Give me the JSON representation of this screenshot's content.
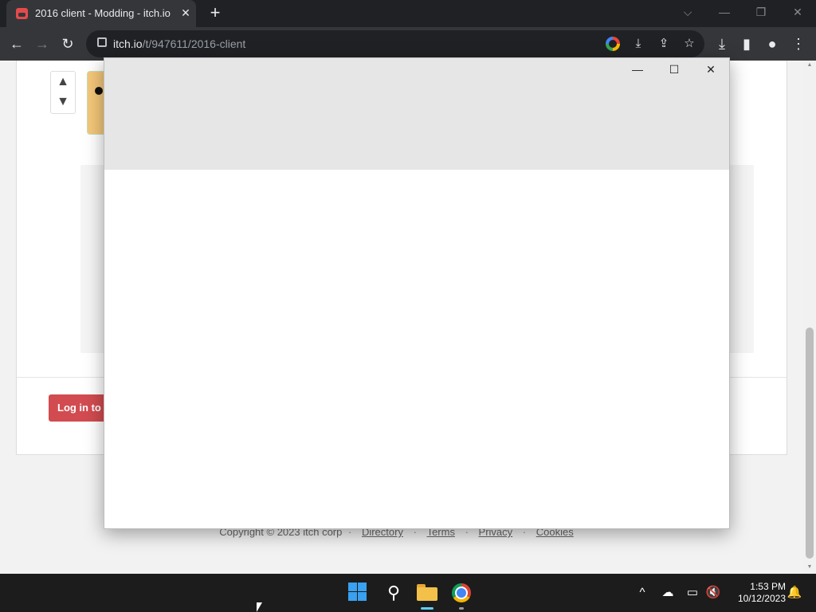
{
  "browser": {
    "tab_title": "2016 client - Modding - itch.io",
    "tab_close": "✕",
    "new_tab": "+",
    "window_controls": {
      "dropdown": "⌵",
      "minimize": "—",
      "restore": "❐",
      "close": "✕"
    },
    "url_host": "itch.io",
    "url_path": "/t/947611/2016-client",
    "toolbar_icons": {
      "back": "←",
      "forward": "→",
      "reload": "↻",
      "install": "⤓",
      "share": "⇪",
      "bookmark": "☆",
      "downloads": "⤓",
      "side_panel": "▮",
      "profile": "●",
      "menu": "⋮"
    }
  },
  "page": {
    "login_button": "Log in to r",
    "footer": {
      "copyright": "Copyright © 2023 itch corp",
      "separator": "·",
      "links": [
        "Directory",
        "Terms",
        "Privacy",
        "Cookies"
      ]
    },
    "vote_up": "▲",
    "vote_down": "▼"
  },
  "popup": {
    "minimize": "—",
    "maximize": "☐",
    "close": "✕"
  },
  "taskbar": {
    "search": "⚲",
    "tray_chevron": "^",
    "clock_time": "1:53 PM",
    "clock_date": "10/12/2023",
    "tray_notification": "🔔"
  }
}
